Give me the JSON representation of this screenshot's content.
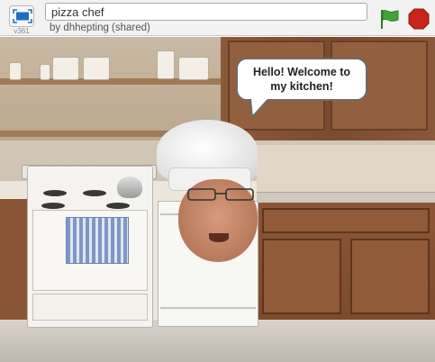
{
  "player": {
    "version": "v361",
    "project_title": "pizza chef",
    "author_line": "by dhhepting (shared)"
  },
  "controls": {
    "fullscreen_icon": "fullscreen-icon",
    "green_flag_icon": "green-flag-icon",
    "stop_icon": "stop-sign-icon"
  },
  "stage": {
    "speech": {
      "line1": "Hello! Welcome to",
      "line2": "my kitchen!"
    }
  },
  "colors": {
    "flag_green": "#3fa535",
    "stop_red": "#c8261b",
    "fullscreen_blue": "#1f6fbf"
  }
}
